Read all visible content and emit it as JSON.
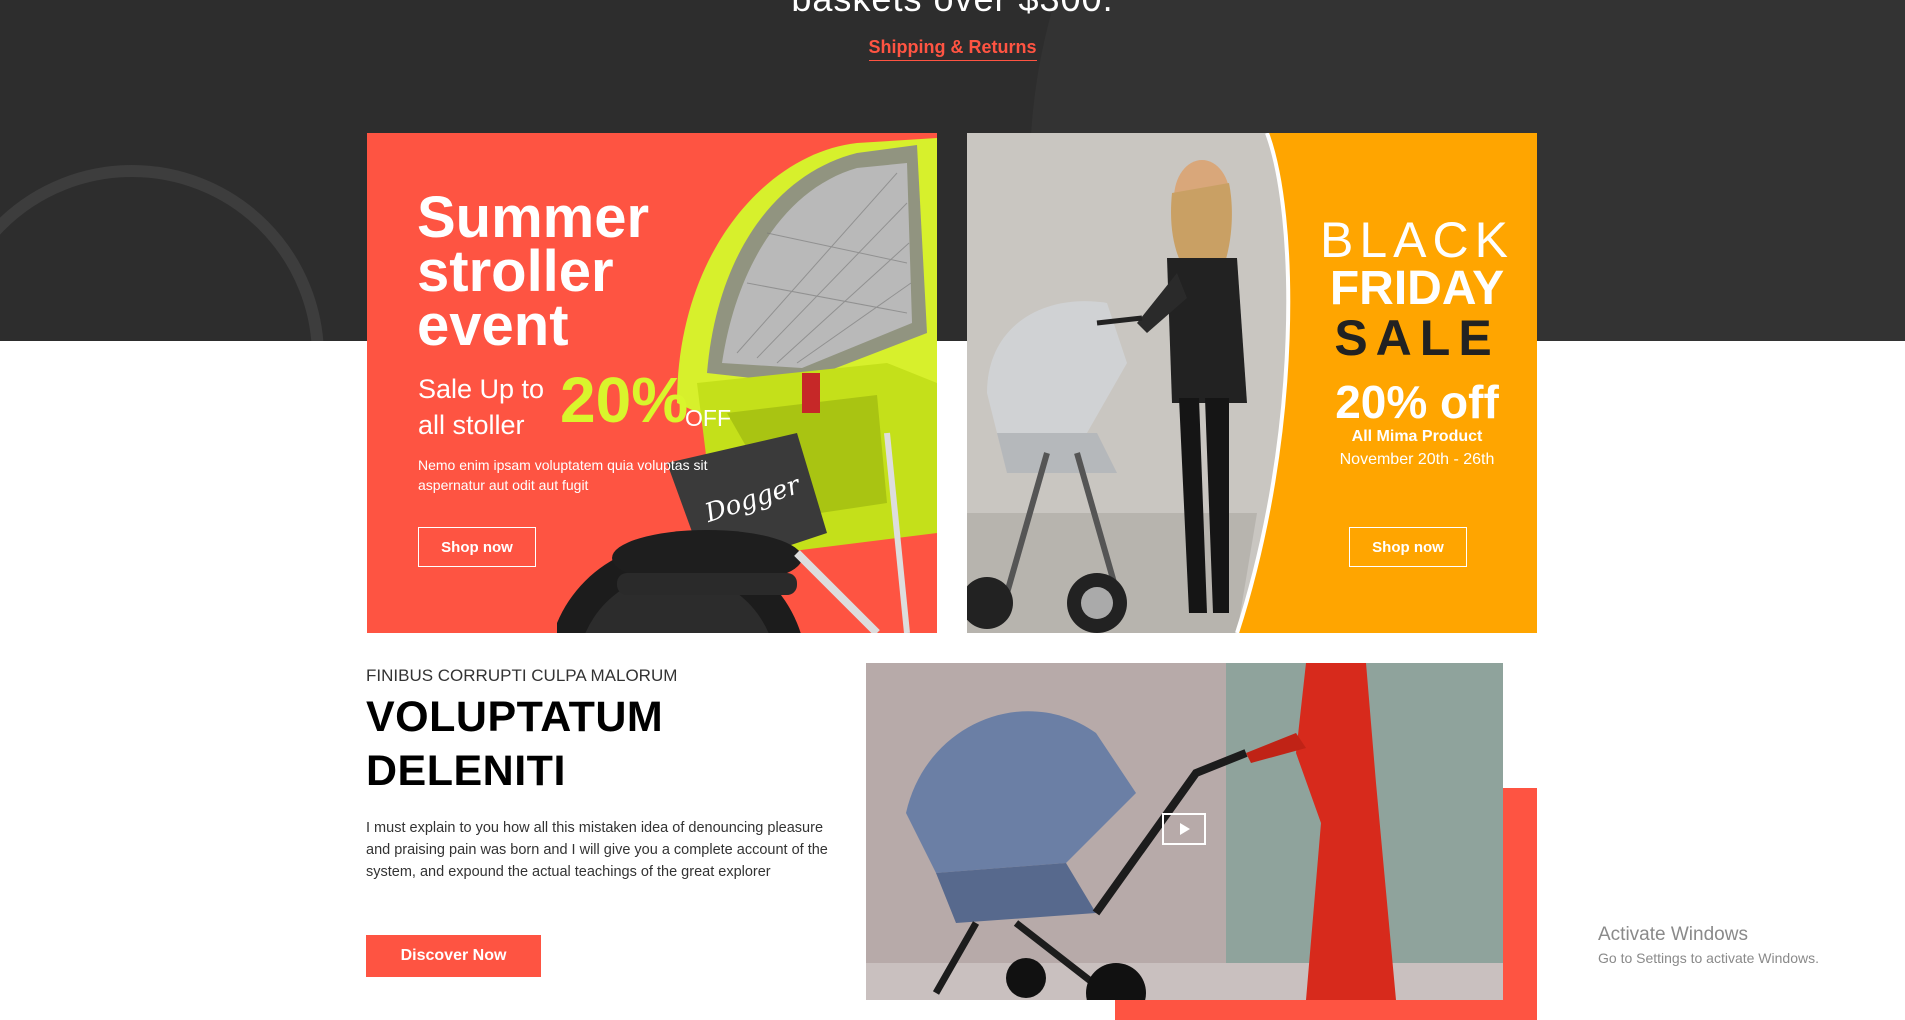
{
  "header": {
    "headline_partial": "baskets over $300.",
    "shipping_link": "Shipping & Returns"
  },
  "promo_summer": {
    "title": "Summer stroller event",
    "sale_text": "Sale Up to all stoller",
    "percent": "20%",
    "off": "OFF",
    "description": "Nemo enim ipsam voluptatem quia voluptas sit aspernatur aut odit aut fugit",
    "button": "Shop now",
    "brand_mark": "Dogger"
  },
  "promo_black_friday": {
    "line1": "BLACK",
    "line2": "FRIDAY",
    "line3": "SALE",
    "percent": "20% off",
    "product": "All Mima Product",
    "dates": "November 20th - 26th",
    "button": "Shop now"
  },
  "feature": {
    "eyebrow": "FINIBUS CORRUPTI CULPA MALORUM",
    "title": "VOLUPTATUM DELENITI",
    "body": "I must explain to you how all this mistaken idea of denouncing pleasure and praising pain was born and I will give you a complete account of the system, and expound the actual teachings of the great explorer",
    "button": "Discover Now"
  },
  "os_overlay": {
    "title": "Activate Windows",
    "subtitle": "Go to Settings to activate Windows."
  },
  "colors": {
    "accent": "#fe5442",
    "dark_band": "#2d2d2d",
    "orange": "#ffa500",
    "lime": "#d9f52c"
  }
}
